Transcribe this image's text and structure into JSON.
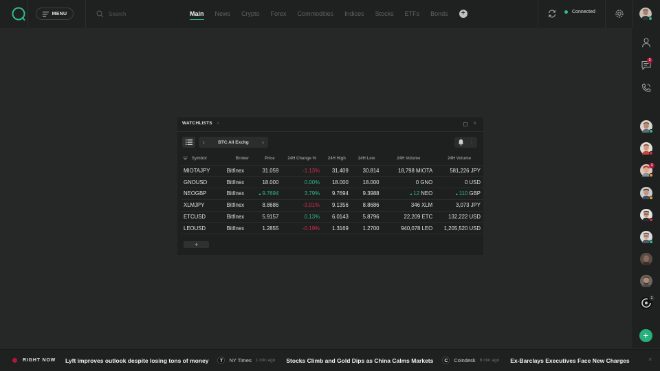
{
  "header": {
    "menu_label": "MENU",
    "search_placeholder": "Search",
    "tabs": [
      {
        "label": "Main",
        "active": true
      },
      {
        "label": "News",
        "active": false
      },
      {
        "label": "Crypto",
        "active": false
      },
      {
        "label": "Forex",
        "active": false
      },
      {
        "label": "Commodities",
        "active": false
      },
      {
        "label": "Indices",
        "active": false
      },
      {
        "label": "Stocks",
        "active": false
      },
      {
        "label": "ETFs",
        "active": false
      },
      {
        "label": "Bonds",
        "active": false
      }
    ],
    "add_tab_icon": "+",
    "connection_status": "Connected",
    "connection_color": "#2fbf8a"
  },
  "sidebar": {
    "messages_badge": "3",
    "contacts": [
      {
        "status": "online",
        "badge": ""
      },
      {
        "status": "busy",
        "badge": ""
      },
      {
        "status": "away",
        "badge": "3"
      },
      {
        "status": "away",
        "badge": ""
      },
      {
        "status": "busy",
        "badge": ""
      },
      {
        "status": "online",
        "badge": ""
      },
      {
        "status": "none",
        "badge": ""
      },
      {
        "status": "none",
        "badge": ""
      },
      {
        "status": "none",
        "badge": "1"
      }
    ],
    "add_icon": "+"
  },
  "watchlist": {
    "title": "WATCHLISTS",
    "list_name": "BTC All Exchg",
    "columns": [
      "Symbol",
      "Broker",
      "Price",
      "24H Change %",
      "24H High",
      "24H Low",
      "24H Volume",
      "24H Volume"
    ],
    "rows": [
      {
        "symbol": "MIOTAJPY",
        "broker": "Bitfinex",
        "price": "31.059",
        "price_dir": "",
        "change": "-1.13%",
        "change_dir": "neg",
        "high": "31.409",
        "low": "30.814",
        "vol1": "18,798",
        "vol1_unit": "MIOTA",
        "vol1_dir": "",
        "vol2": "581,226",
        "vol2_unit": "JPY",
        "vol2_dir": ""
      },
      {
        "symbol": "GNOUSD",
        "broker": "Bitfinex",
        "price": "18.000",
        "price_dir": "",
        "change": "0.00%",
        "change_dir": "pos",
        "high": "18.000",
        "low": "18.000",
        "vol1": "0",
        "vol1_unit": "GNO",
        "vol1_dir": "",
        "vol2": "0",
        "vol2_unit": "USD",
        "vol2_dir": ""
      },
      {
        "symbol": "NEOGBP",
        "broker": "Bitfinex",
        "price": "9.7694",
        "price_dir": "up",
        "change": "3.79%",
        "change_dir": "pos",
        "high": "9.7694",
        "low": "9.3988",
        "vol1": "12",
        "vol1_unit": "NEO",
        "vol1_dir": "up",
        "vol2": "110",
        "vol2_unit": "GBP",
        "vol2_dir": "up"
      },
      {
        "symbol": "XLMJPY",
        "broker": "Bitfinex",
        "price": "8.8686",
        "price_dir": "",
        "change": "-3.01%",
        "change_dir": "neg",
        "high": "9.1356",
        "low": "8.8686",
        "vol1": "346",
        "vol1_unit": "XLM",
        "vol1_dir": "",
        "vol2": "3,073",
        "vol2_unit": "JPY",
        "vol2_dir": ""
      },
      {
        "symbol": "ETCUSD",
        "broker": "Bitfinex",
        "price": "5.9157",
        "price_dir": "",
        "change": "0.13%",
        "change_dir": "pos",
        "high": "6.0143",
        "low": "5.8796",
        "vol1": "22,209",
        "vol1_unit": "ETC",
        "vol1_dir": "",
        "vol2": "132,222",
        "vol2_unit": "USD",
        "vol2_dir": ""
      },
      {
        "symbol": "LEOUSD",
        "broker": "Bitfinex",
        "price": "1.2855",
        "price_dir": "",
        "change": "-0.19%",
        "change_dir": "neg",
        "high": "1.3169",
        "low": "1.2700",
        "vol1": "940,078",
        "vol1_unit": "LEO",
        "vol1_dir": "",
        "vol2": "1,205,520",
        "vol2_unit": "USD",
        "vol2_dir": ""
      }
    ],
    "add_row_icon": "+"
  },
  "ticker": {
    "label": "RIGHT NOW",
    "items": [
      {
        "headline": "Lyft improves outlook despite losing tons of money",
        "source": "NY Times",
        "source_icon": "T",
        "ago": "1 min ago"
      },
      {
        "headline": "Stocks Climb and Gold Dips as China Calms Markets",
        "source": "Coindesk",
        "source_icon": "C",
        "ago": "8 min ago"
      },
      {
        "headline": "Ex-Barclays Executives Face New Charges",
        "source": "",
        "source_icon": "",
        "ago": ""
      }
    ]
  },
  "colors": {
    "accent": "#2fbf8a",
    "negative": "#d6294d",
    "badge": "#b2163a",
    "fab": "#27b07e"
  }
}
